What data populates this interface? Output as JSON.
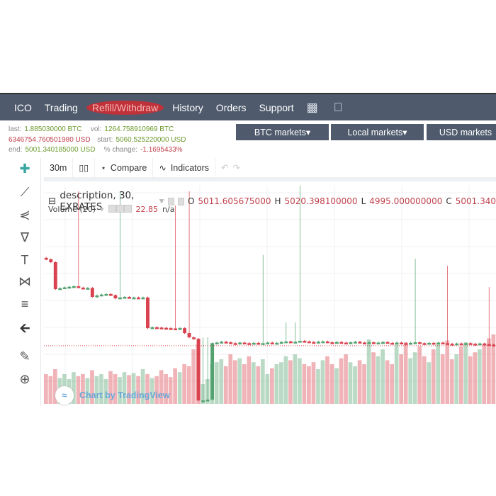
{
  "nav": {
    "items": [
      "ICO",
      "Trading",
      "Refill/Withdraw",
      "History",
      "Orders",
      "Support"
    ],
    "active": "Refill/Withdraw",
    "icons": [
      "android-icon",
      "apple-icon"
    ]
  },
  "info": {
    "last_label": "last:",
    "last": "1.885030000 BTC",
    "vol_label": "vol:",
    "vol": "1264.758910969 BTC",
    "usd": "6346754.760501980 USD",
    "start_label": "start:",
    "start": "5060.525220000 USD",
    "end_label": "end:",
    "end": "5001.340185000 USD",
    "change_label": "% change:",
    "change": "-1.1695433%"
  },
  "markets": [
    "BTC markets",
    "Local markets",
    "USD markets"
  ],
  "toolbar": {
    "interval": "30m",
    "compare": "Compare",
    "indicators": "Indicators"
  },
  "legend": {
    "title": "description, 30, EXRATES",
    "o_label": "O",
    "o": "5011.605675000",
    "h_label": "H",
    "h": "5020.398100000",
    "l_label": "L",
    "l": "4995.000000000",
    "c_label": "C",
    "c": "5001.340",
    "volume_label": "Volume (20)",
    "volume_value": "22.85",
    "volume_na": "n/a"
  },
  "watermark": "Chart by TradingView",
  "colors": {
    "up": "#53a26f",
    "down": "#d9424e",
    "nav": "#4f5b6d"
  },
  "chart_data": {
    "type": "candlestick",
    "last_price": 5001.34,
    "closes": [
      5300,
      5290,
      5197,
      5200,
      5203,
      5205,
      5207,
      5202,
      5200,
      5201,
      5170,
      5175,
      5178,
      5180,
      5176,
      5165,
      5168,
      5170,
      5166,
      5168,
      5167,
      5168,
      5062,
      5065,
      5064,
      5063,
      5062,
      5061,
      5060,
      5062,
      5045,
      5030,
      5025,
      4812,
      4812,
      4815,
      5010,
      5012,
      5015,
      5013,
      5010,
      5008,
      5012,
      5010,
      5009,
      5011,
      5008,
      5010,
      5012,
      5009,
      5011,
      5014,
      5016,
      5013,
      5015,
      5018,
      5016,
      5014,
      5012,
      5015,
      5016,
      5013,
      5011,
      5014,
      5012,
      5010,
      5013,
      5015,
      5012,
      5011,
      5013,
      5010,
      5012,
      5014,
      5011,
      5009,
      5012,
      5010,
      5008,
      5011,
      5013,
      5010,
      5008,
      5011,
      5009,
      5012,
      5010,
      5008,
      5006,
      5009,
      5007,
      5010,
      5008,
      5006,
      5009,
      5007,
      5005,
      5001
    ],
    "spikes": {
      "7": 5535,
      "16": 5535,
      "28": 5486,
      "31": 5535,
      "34": 5030,
      "35": 5030,
      "47": 5315,
      "52": 5082,
      "54": 5082,
      "55": 5555,
      "80": 5302,
      "87": 5278,
      "96": 5204
    },
    "volumes": [
      30,
      28,
      35,
      26,
      30,
      25,
      32,
      28,
      30,
      26,
      34,
      28,
      30,
      25,
      33,
      30,
      27,
      32,
      29,
      31,
      28,
      35,
      30,
      26,
      28,
      34,
      30,
      27,
      36,
      32,
      40,
      38,
      55,
      60,
      20,
      25,
      40,
      42,
      45,
      38,
      50,
      44,
      46,
      40,
      48,
      42,
      38,
      45,
      30,
      36,
      40,
      42,
      48,
      44,
      50,
      46,
      40,
      38,
      42,
      35,
      44,
      48,
      40,
      36,
      46,
      50,
      42,
      38,
      44,
      40,
      65,
      52,
      48,
      55,
      44,
      40,
      60,
      50,
      62,
      46,
      52,
      58,
      48,
      42,
      55,
      60,
      50,
      64,
      45,
      50,
      58,
      62,
      48,
      52,
      55,
      60,
      66,
      70
    ]
  }
}
